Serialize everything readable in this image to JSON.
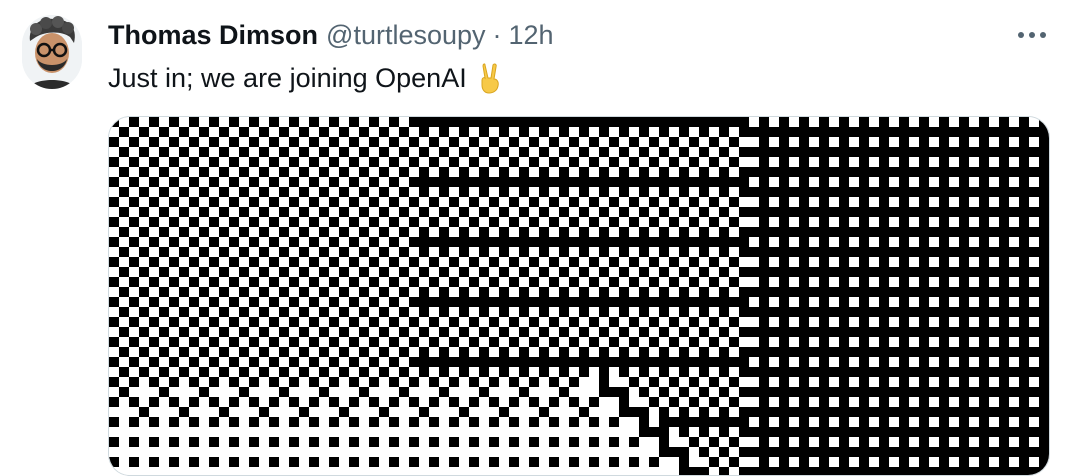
{
  "tweet": {
    "author_name": "Thomas Dimson",
    "author_handle": "@turtlesoupy",
    "separator": "·",
    "timestamp": "12h",
    "text": "Just in; we are joining OpenAI",
    "emoji": "victory-hand-emoji"
  },
  "icons": {
    "more": "more-horizontal-icon",
    "avatar": "profile-avatar"
  },
  "colors": {
    "text": "#0f1419",
    "secondary": "#536471",
    "media_dark": "#000000",
    "media_light": "#ffffff",
    "emoji": "#f7c948"
  }
}
